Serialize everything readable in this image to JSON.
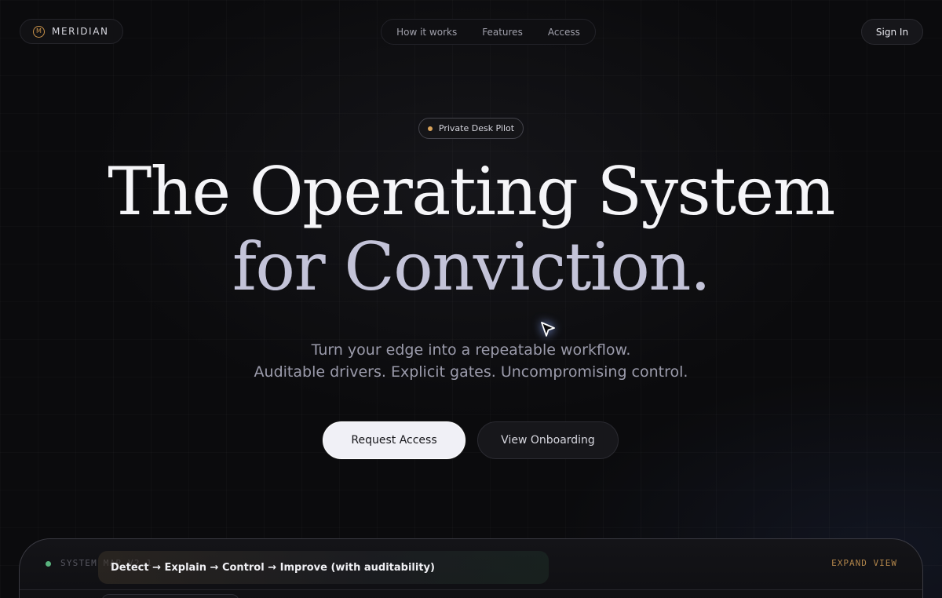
{
  "nav": {
    "brand_name": "MERIDIAN",
    "brand_mark": "M",
    "links": [
      {
        "label": "How it works"
      },
      {
        "label": "Features"
      },
      {
        "label": "Access"
      }
    ],
    "sign_in_label": "Sign In"
  },
  "hero": {
    "badge_text": "Private Desk Pilot",
    "headline_line1": "The Operating System",
    "headline_line2": "for Conviction.",
    "subline1": "Turn your edge into a repeatable workflow.",
    "subline2": "Auditable drivers. Explicit gates. Uncompromising control.",
    "primary_cta": "Request Access",
    "secondary_cta": "View Onboarding"
  },
  "system_map": {
    "label": "SYSTEM MAP V2.1",
    "caption": "Detect → Explain → Control → Improve (with auditability)",
    "expand_label": "EXPAND VIEW",
    "status_color": "#59b37e"
  },
  "colors": {
    "accent": "#c9924a",
    "background": "#0b0b0d",
    "badge_dot": "#d9a35a"
  }
}
